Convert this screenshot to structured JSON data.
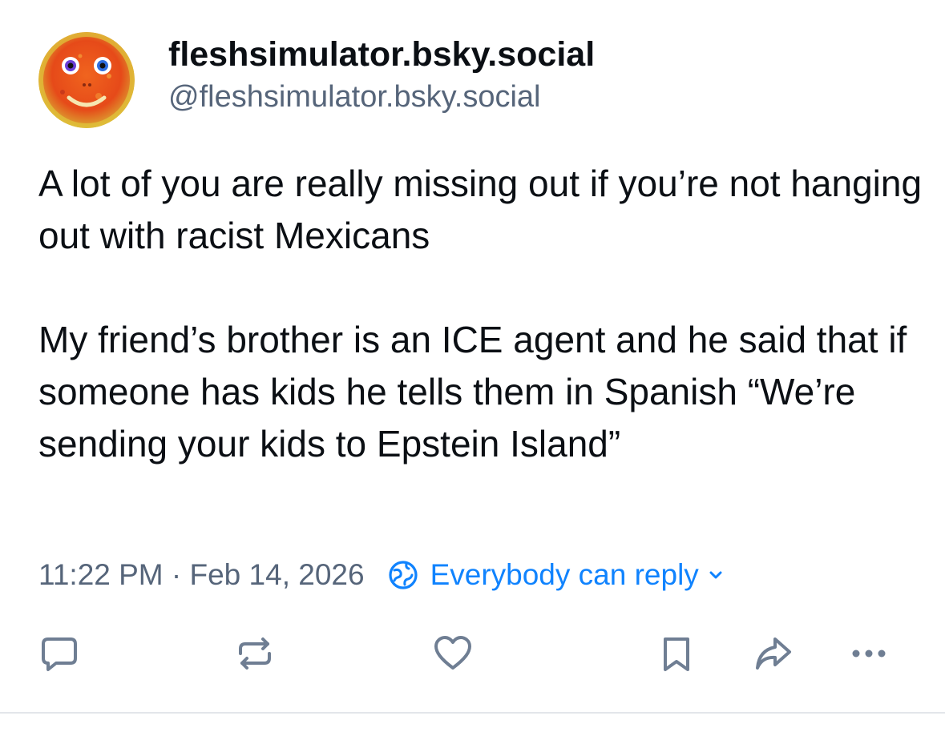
{
  "post": {
    "author": {
      "display_name": "fleshsimulator.bsky.social",
      "handle": "@fleshsimulator.bsky.social",
      "avatar": "orange-textured-smiley-face-avatar"
    },
    "text": {
      "paragraph_1": "A lot of you are really missing out if you’re not hanging out with racist Mexicans",
      "paragraph_2": "My friend’s brother is an ICE agent and he said that if someone has kids he tells them in Spanish “We’re sending your kids to Epstein Island”"
    },
    "timestamp": "11:22 PM · Feb 14, 2026",
    "reply_setting": {
      "label": "Everybody can reply",
      "icon": "globe-icon",
      "chevron": "chevron-down-icon"
    }
  },
  "actions": [
    {
      "name": "reply",
      "icon": "comment-icon"
    },
    {
      "name": "repost",
      "icon": "repost-icon"
    },
    {
      "name": "like",
      "icon": "heart-icon"
    },
    {
      "name": "bookmark",
      "icon": "bookmark-icon"
    },
    {
      "name": "share",
      "icon": "share-icon"
    },
    {
      "name": "more",
      "icon": "ellipsis-icon"
    }
  ],
  "colors": {
    "text": "#0b0f14",
    "muted": "#56657a",
    "accent": "#1083fe",
    "icon": "#6f7e93",
    "divider": "#e3e6ea"
  }
}
